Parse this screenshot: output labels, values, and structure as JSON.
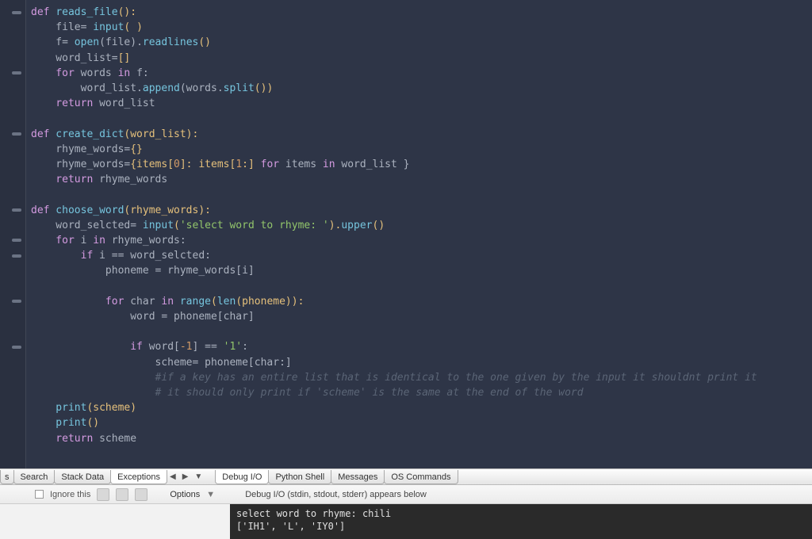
{
  "tabs": {
    "search": "Search",
    "stackdata": "Stack Data",
    "exceptions": "Exceptions",
    "debugio": "Debug I/O",
    "pythonshell": "Python Shell",
    "messages": "Messages",
    "oscommands": "OS Commands",
    "s_prefix": "s"
  },
  "options": {
    "ignore": "Ignore this",
    "options": "Options",
    "debug_label": "Debug I/O (stdin, stdout, stderr) appears below"
  },
  "console": {
    "line1": "select word to rhyme: chili",
    "line2": "['IH1', 'L', 'IY0']"
  },
  "code": {
    "l1_def": "def",
    "l1_fn": "reads_file",
    "l1_rest": "():",
    "l2": "    file= ",
    "l2_fn": "input",
    "l2_rest": "( )",
    "l3": "    f= ",
    "l3_fn": "open",
    "l3_mid": "(file).",
    "l3_fn2": "readlines",
    "l3_end": "()",
    "l4": "    word_list",
    "l4_op": "=",
    "l4_br": "[]",
    "l5_for": "    for",
    "l5_w": " words ",
    "l5_in": "in",
    "l5_f": " f:",
    "l6": "        word_list.",
    "l6_fn": "append",
    "l6_mid": "(words.",
    "l6_fn2": "split",
    "l6_end": "())",
    "l7_ret": "    return",
    "l7_rest": " word_list",
    "l9_def": "def",
    "l9_fn": " create_dict",
    "l9_rest": "(word_list):",
    "l10": "    rhyme_words",
    "l10_op": "=",
    "l10_br": "{}",
    "l11a": "    rhyme_words",
    "l11op": "=",
    "l11b": "{items[",
    "l11z": "0",
    "l11c": "]: items[",
    "l11o": "1",
    "l11d": ":] ",
    "l11for": "for",
    "l11e": " items ",
    "l11in": "in",
    "l11f": " word_list }",
    "l12_ret": "    return",
    "l12_rest": " rhyme_words",
    "l14_def": "def",
    "l14_fn": " choose_word",
    "l14_rest": "(rhyme_words):",
    "l15a": "    word_selcted",
    "l15op": "= ",
    "l15fn": "input",
    "l15b": "(",
    "l15str": "'select word to rhyme: '",
    "l15c": ").",
    "l15fn2": "upper",
    "l15d": "()",
    "l16_for": "    for",
    "l16_i": " i ",
    "l16_in": "in",
    "l16_r": " rhyme_words:",
    "l17_if": "        if",
    "l17_rest": " i == word_selcted:",
    "l18": "            phoneme = rhyme_words[i]",
    "l20_for": "            for",
    "l20_c": " char ",
    "l20_in": "in",
    "l20_sp": " ",
    "l20_fn": "range",
    "l20_a": "(",
    "l20_fn2": "len",
    "l20_b": "(phoneme)):",
    "l21": "                word = phoneme[char]",
    "l23_if": "                if",
    "l23_a": " word[",
    "l23_n": "-1",
    "l23_b": "] == ",
    "l23_s": "'1'",
    "l23_c": ":",
    "l24": "                    scheme= phoneme[char:]",
    "l25": "                    #if a key has an entire list that is identical to the one given by the input it shouldnt print it",
    "l26": "                    # it should only print if 'scheme' is the same at the end of the word",
    "l27_fn": "    print",
    "l27_rest": "(scheme)",
    "l28_fn": "    print",
    "l28_rest": "()",
    "l29_ret": "    return",
    "l29_rest": " scheme"
  }
}
